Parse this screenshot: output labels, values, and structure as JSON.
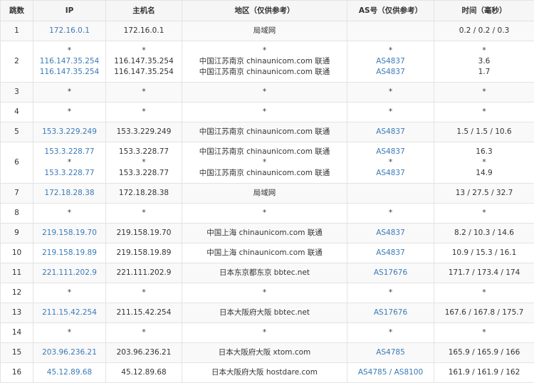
{
  "headers": {
    "hop": "跳数",
    "ip": "IP",
    "host": "主机名",
    "region": "地区（仅供参考）",
    "as": "AS号（仅供参考）",
    "time": "时间（毫秒）"
  },
  "rows": [
    {
      "hop": "1",
      "ip": [
        "172.16.0.1"
      ],
      "host": [
        "172.16.0.1"
      ],
      "region": [
        "局域网"
      ],
      "as": [
        ""
      ],
      "time": [
        "0.2 / 0.2 / 0.3"
      ]
    },
    {
      "hop": "2",
      "ip": [
        "*",
        "116.147.35.254",
        "116.147.35.254"
      ],
      "host": [
        "*",
        "116.147.35.254",
        "116.147.35.254"
      ],
      "region": [
        "*",
        "中国江苏南京 chinaunicom.com 联通",
        "中国江苏南京 chinaunicom.com 联通"
      ],
      "as": [
        "*",
        "AS4837",
        "AS4837"
      ],
      "time": [
        "*",
        "3.6",
        "1.7"
      ]
    },
    {
      "hop": "3",
      "ip": [
        "*"
      ],
      "host": [
        "*"
      ],
      "region": [
        "*"
      ],
      "as": [
        "*"
      ],
      "time": [
        "*"
      ]
    },
    {
      "hop": "4",
      "ip": [
        "*"
      ],
      "host": [
        "*"
      ],
      "region": [
        "*"
      ],
      "as": [
        "*"
      ],
      "time": [
        "*"
      ]
    },
    {
      "hop": "5",
      "ip": [
        "153.3.229.249"
      ],
      "host": [
        "153.3.229.249"
      ],
      "region": [
        "中国江苏南京 chinaunicom.com 联通"
      ],
      "as": [
        "AS4837"
      ],
      "time": [
        "1.5 / 1.5 / 10.6"
      ]
    },
    {
      "hop": "6",
      "ip": [
        "153.3.228.77",
        "*",
        "153.3.228.77"
      ],
      "host": [
        "153.3.228.77",
        "*",
        "153.3.228.77"
      ],
      "region": [
        "中国江苏南京 chinaunicom.com 联通",
        "*",
        "中国江苏南京 chinaunicom.com 联通"
      ],
      "as": [
        "AS4837",
        "*",
        "AS4837"
      ],
      "time": [
        "16.3",
        "*",
        "14.9"
      ]
    },
    {
      "hop": "7",
      "ip": [
        "172.18.28.38"
      ],
      "host": [
        "172.18.28.38"
      ],
      "region": [
        "局域网"
      ],
      "as": [
        ""
      ],
      "time": [
        "13 / 27.5 / 32.7"
      ]
    },
    {
      "hop": "8",
      "ip": [
        "*"
      ],
      "host": [
        "*"
      ],
      "region": [
        "*"
      ],
      "as": [
        "*"
      ],
      "time": [
        "*"
      ]
    },
    {
      "hop": "9",
      "ip": [
        "219.158.19.70"
      ],
      "host": [
        "219.158.19.70"
      ],
      "region": [
        "中国上海 chinaunicom.com 联通"
      ],
      "as": [
        "AS4837"
      ],
      "time": [
        "8.2 / 10.3 / 14.6"
      ]
    },
    {
      "hop": "10",
      "ip": [
        "219.158.19.89"
      ],
      "host": [
        "219.158.19.89"
      ],
      "region": [
        "中国上海 chinaunicom.com 联通"
      ],
      "as": [
        "AS4837"
      ],
      "time": [
        "10.9 / 15.3 / 16.1"
      ]
    },
    {
      "hop": "11",
      "ip": [
        "221.111.202.9"
      ],
      "host": [
        "221.111.202.9"
      ],
      "region": [
        "日本东京都东京 bbtec.net"
      ],
      "as": [
        "AS17676"
      ],
      "time": [
        "171.7 / 173.4 / 174"
      ]
    },
    {
      "hop": "12",
      "ip": [
        "*"
      ],
      "host": [
        "*"
      ],
      "region": [
        "*"
      ],
      "as": [
        "*"
      ],
      "time": [
        "*"
      ]
    },
    {
      "hop": "13",
      "ip": [
        "211.15.42.254"
      ],
      "host": [
        "211.15.42.254"
      ],
      "region": [
        "日本大阪府大阪 bbtec.net"
      ],
      "as": [
        "AS17676"
      ],
      "time": [
        "167.6 / 167.8 / 175.7"
      ]
    },
    {
      "hop": "14",
      "ip": [
        "*"
      ],
      "host": [
        "*"
      ],
      "region": [
        "*"
      ],
      "as": [
        "*"
      ],
      "time": [
        "*"
      ]
    },
    {
      "hop": "15",
      "ip": [
        "203.96.236.21"
      ],
      "host": [
        "203.96.236.21"
      ],
      "region": [
        "日本大阪府大阪 xtom.com"
      ],
      "as": [
        "AS4785"
      ],
      "time": [
        "165.9 / 165.9 / 166"
      ]
    },
    {
      "hop": "16",
      "ip": [
        "45.12.89.68"
      ],
      "host": [
        "45.12.89.68"
      ],
      "region": [
        "日本大阪府大阪 hostdare.com"
      ],
      "as": [
        "AS4785 / AS8100"
      ],
      "time": [
        "161.9 / 161.9 / 162"
      ]
    }
  ],
  "colors": {
    "link": "#3a7ab8",
    "text": "#333333",
    "border": "#e3e3e3",
    "header_bg": "#f6f6f6",
    "stripe_bg": "#f9f9f9"
  }
}
